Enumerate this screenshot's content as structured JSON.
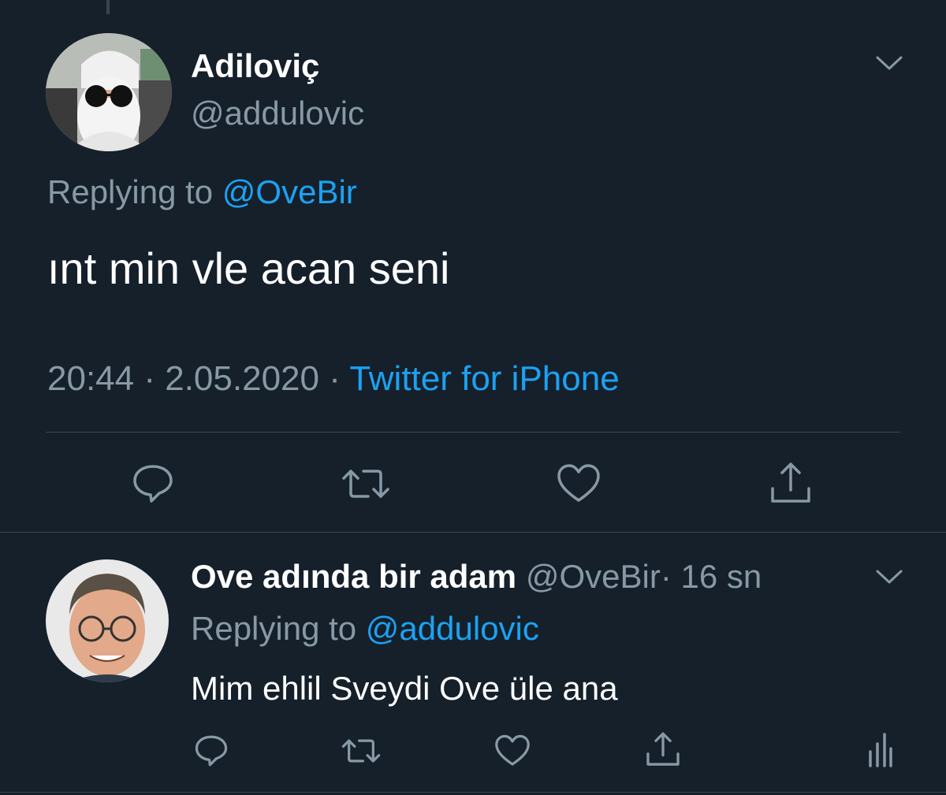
{
  "main_tweet": {
    "display_name": "Adiloviç",
    "handle": "@addulovic",
    "replying_prefix": "Replying to ",
    "replying_to": "@OveBir",
    "text": "ınt min vle acan seni",
    "time": "20:44",
    "date": "2.05.2020",
    "separator": "·",
    "source": "Twitter for iPhone"
  },
  "reply_tweet": {
    "display_name": "Ove adında bir adam",
    "handle": "@OveBir",
    "separator": "·",
    "age": "16 sn",
    "replying_prefix": "Replying to ",
    "replying_to": "@addulovic",
    "text": "Mim ehlil Sveydi Ove üle ana"
  },
  "icons": [
    "chevron-down-icon",
    "reply-icon",
    "retweet-icon",
    "like-icon",
    "share-icon",
    "analytics-icon"
  ],
  "colors": {
    "background": "#15202b",
    "text": "#ffffff",
    "muted": "#8899a6",
    "link": "#1da1f2",
    "divider": "#38444d"
  }
}
